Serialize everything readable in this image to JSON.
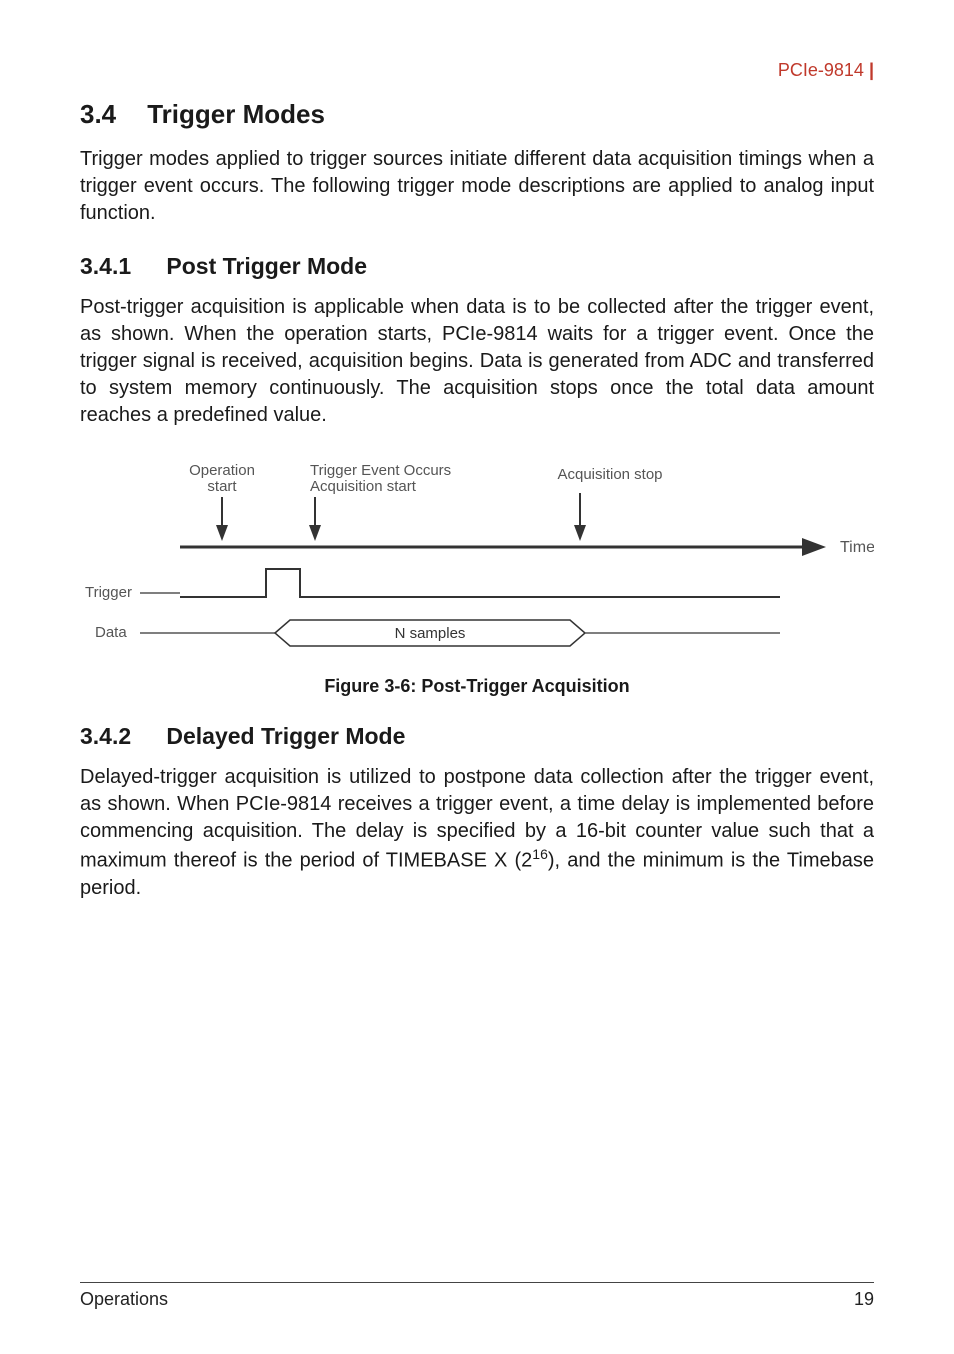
{
  "header": {
    "product": "PCIe-9814"
  },
  "section": {
    "number": "3.4",
    "title": "Trigger Modes",
    "intro": "Trigger modes applied to trigger sources initiate different data acquisition timings when a trigger event occurs. The following trigger mode descriptions are applied to analog input function."
  },
  "sub1": {
    "number": "3.4.1",
    "title": "Post Trigger Mode",
    "body": "Post-trigger acquisition is applicable when data is to be collected after the trigger event, as shown. When the operation starts, PCIe-9814 waits for a trigger event. Once the trigger signal is received, acquisition begins. Data is generated from ADC and transferred to system memory continuously. The acquisition stops once the total data amount reaches a predefined value."
  },
  "figure": {
    "labels": {
      "op_start_l1": "Operation",
      "op_start_l2": "start",
      "trig_evt_l1": "Trigger Event Occurs",
      "trig_evt_l2": "Acquisition start",
      "acq_stop": "Acquisition stop",
      "time": "Time",
      "trigger": "Trigger",
      "data": "Data",
      "nsamples": "N samples"
    },
    "caption": "Figure 3-6: Post-Trigger Acquisition"
  },
  "sub2": {
    "number": "3.4.2",
    "title": "Delayed Trigger Mode",
    "body_pre": "Delayed-trigger acquisition is utilized to postpone data collection after the trigger event, as shown. When PCIe-9814 receives a trigger event, a time delay is implemented before commencing acquisition. The delay is specified by a 16-bit counter value such that a maximum thereof is the period of TIMEBASE X (2",
    "body_sup": "16",
    "body_post": "), and the minimum is the Timebase period."
  },
  "footer": {
    "left": "Operations",
    "right": "19"
  }
}
